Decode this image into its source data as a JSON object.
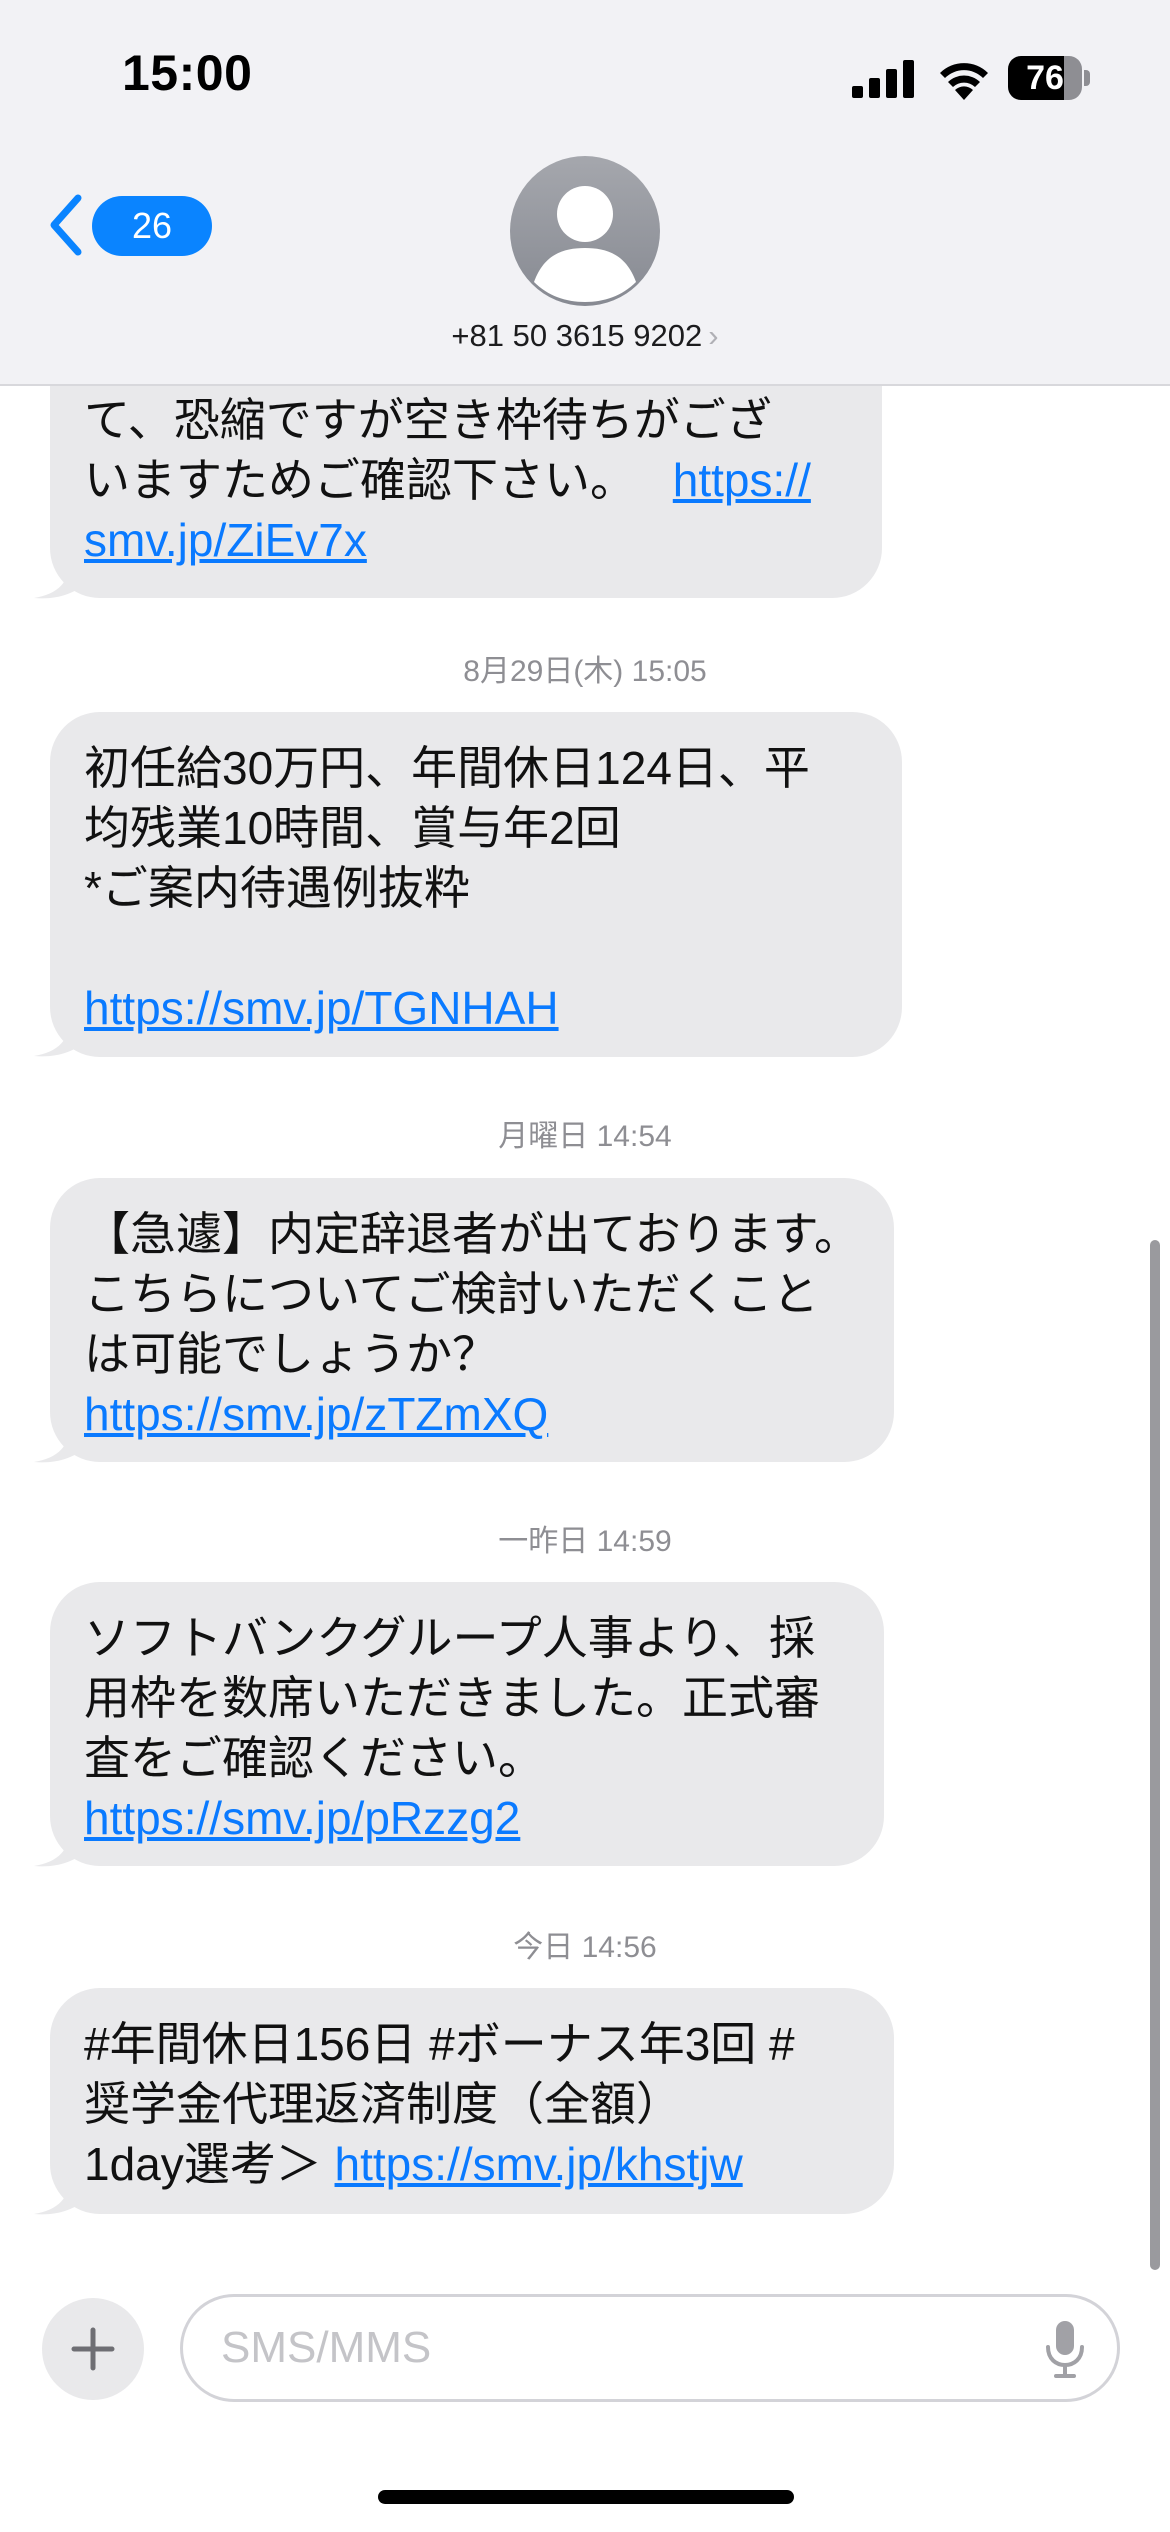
{
  "status_bar": {
    "time": "15:00",
    "battery_level": "76",
    "icons": [
      "signal-icon",
      "wifi-icon",
      "battery-icon"
    ]
  },
  "header": {
    "back_count": "26",
    "contact_number": "+81 50 3615 9202",
    "chevron": "›",
    "icons": [
      "back-chevron-icon",
      "avatar-person-icon",
      "chevron-right-icon"
    ]
  },
  "messages": [
    {
      "lines": [
        "て、恐縮ですが空き枠待ちがござ",
        "いますためご確認下さい。"
      ],
      "link_prefix": "https://",
      "link_rest": "smv.jp/ZiEv7x"
    },
    {
      "timestamp": "8月29日(木) 15:05",
      "lines": [
        "初任給30万円、年間休日124日、平",
        "均残業10時間、賞与年2回",
        "*ご案内待遇例抜粋"
      ],
      "link": "https://smv.jp/TGNHAH"
    },
    {
      "timestamp": "月曜日 14:54",
      "lines": [
        "【急遽】内定辞退者が出ております。",
        "こちらについてご検討いただくこと",
        "は可能でしょうか？"
      ],
      "link": "https://smv.jp/zTZmXQ"
    },
    {
      "timestamp": "一昨日 14:59",
      "lines": [
        "ソフトバンクグループ人事より、採",
        "用枠を数席いただきました。正式審",
        "査をご確認ください。"
      ],
      "link": "https://smv.jp/pRzzg2"
    },
    {
      "timestamp": "今日 14:56",
      "lines": [
        "#年間休日156日 #ボーナス年3回 #",
        "奨学金代理返済制度（全額）"
      ],
      "last_line_prefix": "1day選考＞",
      "link": "https://smv.jp/khstjw"
    }
  ],
  "composer": {
    "placeholder": "SMS/MMS",
    "icons": [
      "plus-icon",
      "microphone-icon"
    ]
  },
  "colors": {
    "accent": "#0a84ff",
    "link": "#0a7aff",
    "bubble": "#e9e9eb",
    "header_bg": "#f2f2f5",
    "timestamp": "#8e8e93"
  }
}
